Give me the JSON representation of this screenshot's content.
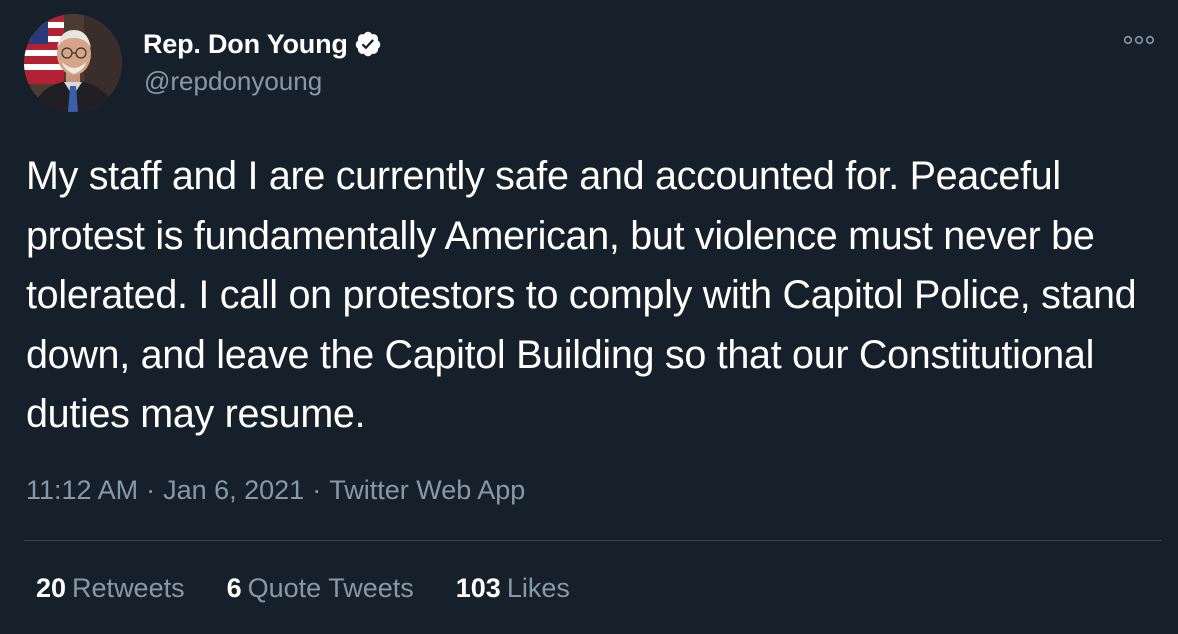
{
  "author": {
    "display_name": "Rep. Don Young",
    "handle": "@repdonyoung",
    "verified": true
  },
  "tweet": {
    "text": "My staff and I are currently safe and accounted for. Peaceful protest is fundamentally American, but violence must never be tolerated. I call on protestors to comply with Capitol Police, stand down, and leave the Capitol Building so that our Constitutional duties may resume.",
    "time": "11:12 AM",
    "date": "Jan 6, 2021",
    "source": "Twitter Web App",
    "separator": "·"
  },
  "stats": {
    "retweets": {
      "count": "20",
      "label": "Retweets"
    },
    "quote_tweets": {
      "count": "6",
      "label": "Quote Tweets"
    },
    "likes": {
      "count": "103",
      "label": "Likes"
    }
  },
  "icons": {
    "verified": "verified-badge-icon",
    "more": "more-options-icon"
  },
  "colors": {
    "background": "#15202b",
    "text": "#ffffff",
    "secondary_text": "#8899a6",
    "divider": "#38444d"
  }
}
